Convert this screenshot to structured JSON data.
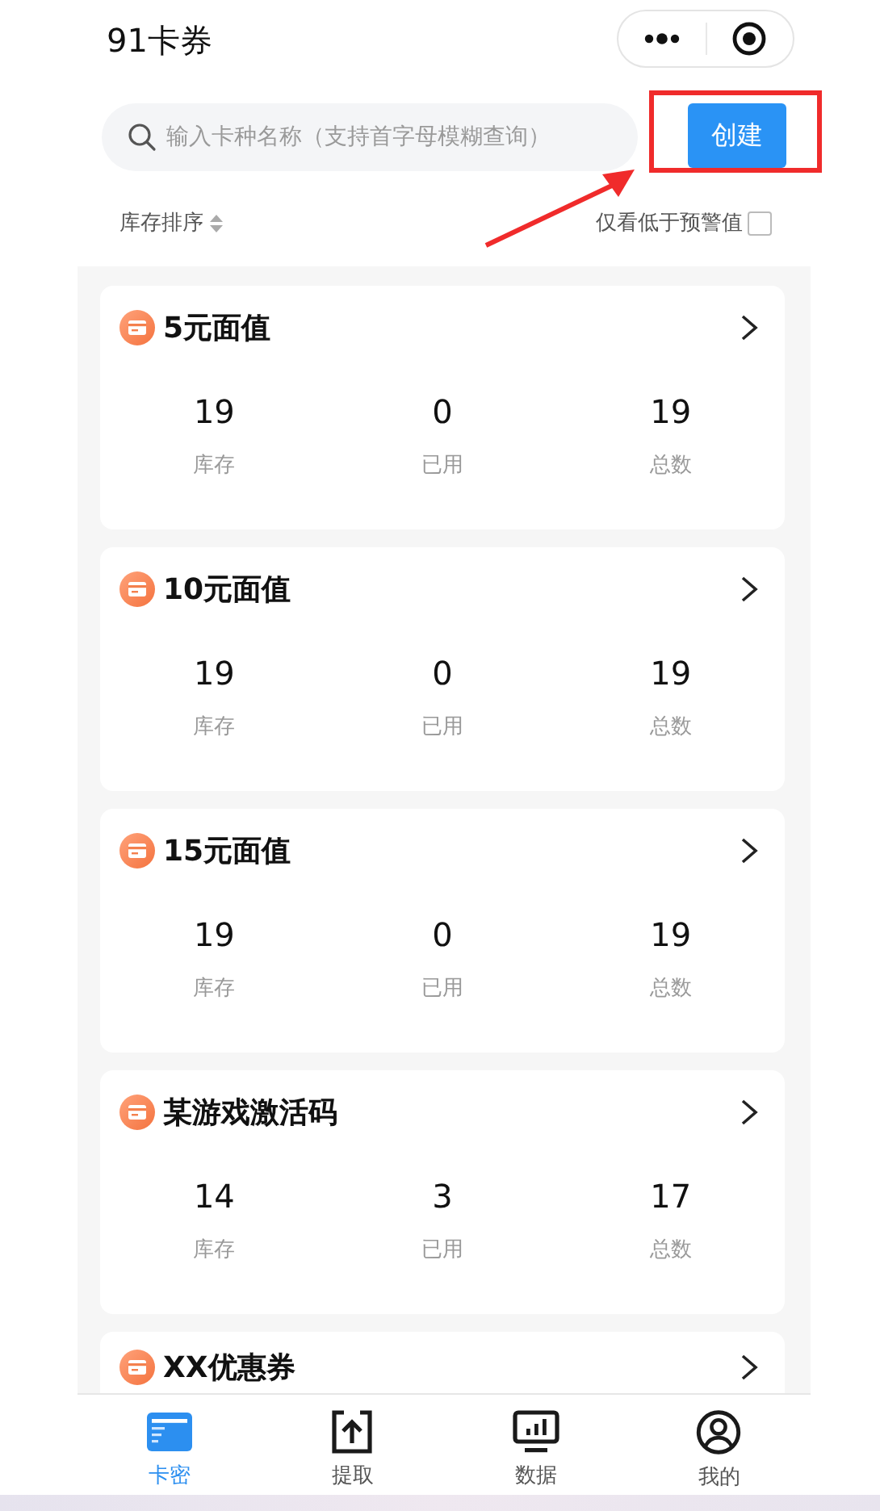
{
  "header": {
    "title": "91卡券"
  },
  "search": {
    "placeholder": "输入卡种名称（支持首字母模糊查询）"
  },
  "create_button": "创建",
  "sort": {
    "label": "库存排序"
  },
  "warning_filter": {
    "label": "仅看低于预警值",
    "checked": false
  },
  "cards": [
    {
      "name": "5元面值",
      "stats": [
        {
          "value": "19",
          "label": "库存"
        },
        {
          "value": "0",
          "label": "已用"
        },
        {
          "value": "19",
          "label": "总数"
        }
      ]
    },
    {
      "name": "10元面值",
      "stats": [
        {
          "value": "19",
          "label": "库存"
        },
        {
          "value": "0",
          "label": "已用"
        },
        {
          "value": "19",
          "label": "总数"
        }
      ]
    },
    {
      "name": "15元面值",
      "stats": [
        {
          "value": "19",
          "label": "库存"
        },
        {
          "value": "0",
          "label": "已用"
        },
        {
          "value": "19",
          "label": "总数"
        }
      ]
    },
    {
      "name": "某游戏激活码",
      "stats": [
        {
          "value": "14",
          "label": "库存"
        },
        {
          "value": "3",
          "label": "已用"
        },
        {
          "value": "17",
          "label": "总数"
        }
      ]
    },
    {
      "name": "XX优惠券"
    }
  ],
  "tab_bar": [
    {
      "label": "卡密",
      "kind": "cards",
      "selected": true
    },
    {
      "label": "提取",
      "kind": "upload",
      "selected": false
    },
    {
      "label": "数据",
      "kind": "chart",
      "selected": false
    },
    {
      "label": "我的",
      "kind": "profile",
      "selected": false
    }
  ]
}
